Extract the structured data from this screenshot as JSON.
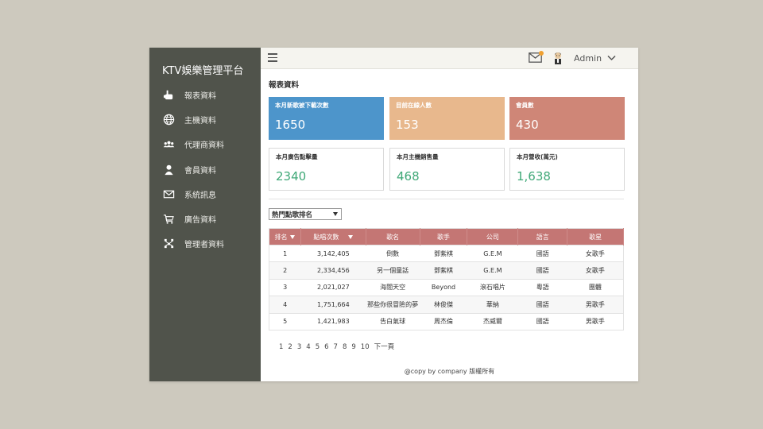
{
  "app": {
    "title": "KTV娛樂管理平台"
  },
  "sidebar": {
    "items": [
      {
        "label": "報表資料",
        "icon": "hand-pointer-icon"
      },
      {
        "label": "主機資料",
        "icon": "globe-icon"
      },
      {
        "label": "代理商資料",
        "icon": "users-group-icon"
      },
      {
        "label": "會員資料",
        "icon": "user-icon"
      },
      {
        "label": "系統訊息",
        "icon": "mail-icon"
      },
      {
        "label": "廣告資料",
        "icon": "cart-icon"
      },
      {
        "label": "管理者資料",
        "icon": "sitemap-icon"
      }
    ]
  },
  "topbar": {
    "admin_label": "Admin",
    "notification_color": "#f0a030"
  },
  "main": {
    "section_title": "報表資料",
    "stats": [
      {
        "label": "本月新歌被下載次數",
        "value": "1650",
        "color": "#4d95cb"
      },
      {
        "label": "目前在線人數",
        "value": "153",
        "color": "#e8b88d"
      },
      {
        "label": "會員數",
        "value": "430",
        "color": "#cf8677"
      },
      {
        "label": "本月廣告點擊量",
        "value": "2340"
      },
      {
        "label": "本月主機銷售量",
        "value": "468"
      },
      {
        "label": "本月營收(萬元)",
        "value": "1,638"
      }
    ],
    "value_color": "#3fa877",
    "ranking_select": "熱門點歌排名",
    "table": {
      "headers": [
        "排名",
        "點唱次數",
        "歌名",
        "歌手",
        "公司",
        "語言",
        "歌星"
      ],
      "header_color": "#c47674",
      "rows": [
        [
          "1",
          "3,142,405",
          "倒數",
          "鄧紫棋",
          "G.E.M",
          "國語",
          "女歌手"
        ],
        [
          "2",
          "2,334,456",
          "另一個童話",
          "鄧紫棋",
          "G.E.M",
          "國語",
          "女歌手"
        ],
        [
          "3",
          "2,021,027",
          "海闊天空",
          "Beyond",
          "滾石唱片",
          "粵語",
          "團體"
        ],
        [
          "4",
          "1,751,664",
          "那些你很冒險的夢",
          "林俊傑",
          "華納",
          "國語",
          "男歌手"
        ],
        [
          "5",
          "1,421,983",
          "告白氣球",
          "周杰倫",
          "杰威爾",
          "國語",
          "男歌手"
        ]
      ]
    },
    "pagination": [
      "1",
      "2",
      "3",
      "4",
      "5",
      "6",
      "7",
      "8",
      "9",
      "10",
      "下一頁"
    ]
  },
  "footer": {
    "text": "@copy by company 版權所有"
  }
}
